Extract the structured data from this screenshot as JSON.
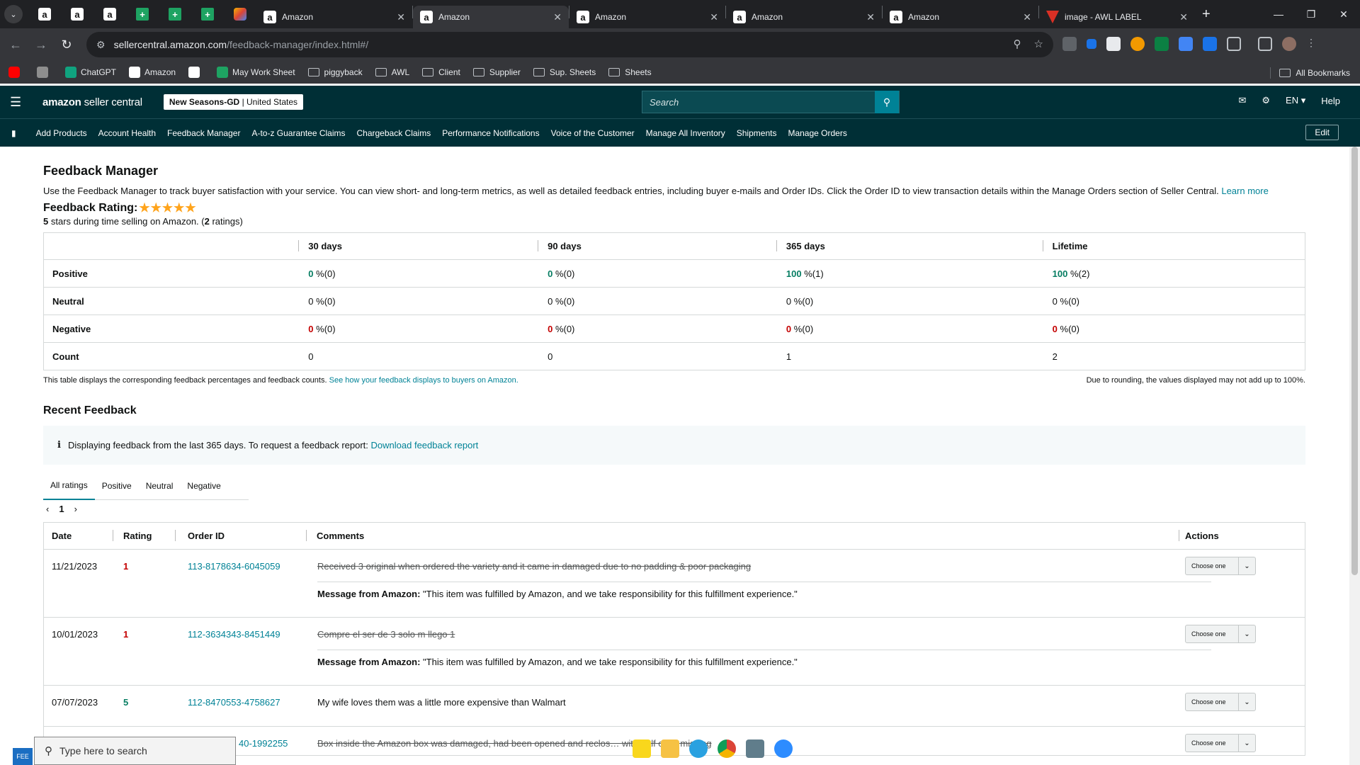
{
  "browser": {
    "tabs": [
      {
        "title": "Amazon"
      },
      {
        "title": "Amazon"
      },
      {
        "title": "Amazon"
      },
      {
        "title": "Amazon"
      },
      {
        "title": "Amazon"
      },
      {
        "title": "image - AWL LABEL"
      }
    ],
    "pinned": [
      "a",
      "a",
      "a",
      "+",
      "+",
      "+",
      "multi"
    ],
    "new_tab": "+",
    "url_host": "sellercentral.amazon.com",
    "url_path": "/feedback-manager/index.html#/",
    "bookmarks": [
      {
        "label": "",
        "icon": "youtube-icon"
      },
      {
        "label": "",
        "icon": "extension-icon"
      },
      {
        "label": "ChatGPT",
        "icon": "chatgpt-icon"
      },
      {
        "label": "Amazon",
        "icon": "amazon-icon"
      },
      {
        "label": "",
        "icon": "amazon-icon"
      },
      {
        "label": "May Work Sheet",
        "icon": "sheets-icon"
      },
      {
        "label": "piggyback",
        "icon": "folder-icon"
      },
      {
        "label": "AWL",
        "icon": "folder-icon"
      },
      {
        "label": "Client",
        "icon": "folder-icon"
      },
      {
        "label": "Supplier",
        "icon": "folder-icon"
      },
      {
        "label": "Sup. Sheets",
        "icon": "folder-icon"
      },
      {
        "label": "Sheets",
        "icon": "folder-icon"
      }
    ],
    "all_bookmarks": "All Bookmarks"
  },
  "header": {
    "logo_main": "amazon",
    "logo_rest": " seller central",
    "store_name": "New Seasons-GD",
    "store_region": " | United States",
    "search_placeholder": "Search",
    "language": "EN ▾",
    "help": "Help"
  },
  "nav": {
    "items": [
      "Add Products",
      "Account Health",
      "Feedback Manager",
      "A-to-z Guarantee Claims",
      "Chargeback Claims",
      "Performance Notifications",
      "Voice of the Customer",
      "Manage All Inventory",
      "Shipments",
      "Manage Orders"
    ],
    "edit": "Edit"
  },
  "page": {
    "title": "Feedback Manager",
    "description": "Use the Feedback Manager to track buyer satisfaction with your service. You can view short- and long-term metrics, as well as detailed feedback entries, including buyer e-mails and Order IDs. Click the Order ID to view transaction details within the Manage Orders section of Seller Central.",
    "learn_more": "Learn more",
    "rating_label": "Feedback Rating:",
    "stars": "★★★★★",
    "rating_value": "5",
    "rating_sub_rest": " stars during time selling on Amazon. (",
    "rating_count": "2",
    "rating_sub_end": " ratings)"
  },
  "metrics": {
    "columns": [
      "30 days",
      "90 days",
      "365 days",
      "Lifetime"
    ],
    "rows": [
      {
        "label": "Positive",
        "cells": [
          {
            "v": "0",
            "s": " %(0)",
            "c": "g"
          },
          {
            "v": "0",
            "s": " %(0)",
            "c": "g"
          },
          {
            "v": "100",
            "s": " %(1)",
            "c": "g"
          },
          {
            "v": "100",
            "s": " %(2)",
            "c": "g"
          }
        ]
      },
      {
        "label": "Neutral",
        "cells": [
          {
            "v": "0",
            "s": " %(0)",
            "c": ""
          },
          {
            "v": "0",
            "s": " %(0)",
            "c": ""
          },
          {
            "v": "0",
            "s": " %(0)",
            "c": ""
          },
          {
            "v": "0",
            "s": " %(0)",
            "c": ""
          }
        ]
      },
      {
        "label": "Negative",
        "cells": [
          {
            "v": "0",
            "s": " %(0)",
            "c": "r"
          },
          {
            "v": "0",
            "s": " %(0)",
            "c": "r"
          },
          {
            "v": "0",
            "s": " %(0)",
            "c": "r"
          },
          {
            "v": "0",
            "s": " %(0)",
            "c": "r"
          }
        ]
      },
      {
        "label": "Count",
        "cells": [
          {
            "v": "0",
            "s": "",
            "c": ""
          },
          {
            "v": "0",
            "s": "",
            "c": ""
          },
          {
            "v": "1",
            "s": "",
            "c": ""
          },
          {
            "v": "2",
            "s": "",
            "c": ""
          }
        ]
      }
    ],
    "note_left": "This table displays the corresponding feedback percentages and feedback counts.",
    "note_link": "See how your feedback displays to buyers on Amazon.",
    "note_right": "Due to rounding, the values displayed may not add up to 100%."
  },
  "recent": {
    "title": "Recent Feedback",
    "alert_text": "Displaying feedback from the last 365 days. To request a feedback report:",
    "alert_link": "Download feedback report",
    "filter_tabs": [
      "All ratings",
      "Positive",
      "Neutral",
      "Negative"
    ],
    "page": "1",
    "columns": [
      "Date",
      "Rating",
      "Order ID",
      "Comments",
      "Actions"
    ],
    "rows": [
      {
        "date": "11/21/2023",
        "rating": "1",
        "rating_color": "#c40000",
        "order": "113-8178634-6045059",
        "comment": "Received 3 original when ordered the variety and it came in damaged due to no padding & poor packaging",
        "struck": true,
        "msg_label": "Message from Amazon:",
        "msg": " \"This item was fulfilled by Amazon, and we take responsibility for this fulfillment experience.\"",
        "action": "Choose one"
      },
      {
        "date": "10/01/2023",
        "rating": "1",
        "rating_color": "#c40000",
        "order": "112-3634343-8451449",
        "comment": "Compre el ser de 3 solo m llego 1",
        "struck": true,
        "msg_label": "Message from Amazon:",
        "msg": " \"This item was fulfilled by Amazon, and we take responsibility for this fulfillment experience.\"",
        "action": "Choose one"
      },
      {
        "date": "07/07/2023",
        "rating": "5",
        "rating_color": "#067d62",
        "order": "112-8470553-4758627",
        "comment": "My wife loves them was a little more expensive than Walmart",
        "struck": false,
        "msg_label": "",
        "msg": "",
        "action": "Choose one"
      },
      {
        "date": "",
        "rating": "",
        "rating_color": "#c40000",
        "order": "40-1992255",
        "comment": "Box inside the Amazon box was damaged, had been opened and reclos… with half of … missing",
        "struck": true,
        "msg_label": "",
        "msg": "",
        "action": "Choose one"
      }
    ]
  },
  "taskbar": {
    "search_placeholder": "Type here to search",
    "left_label": "FEE"
  }
}
